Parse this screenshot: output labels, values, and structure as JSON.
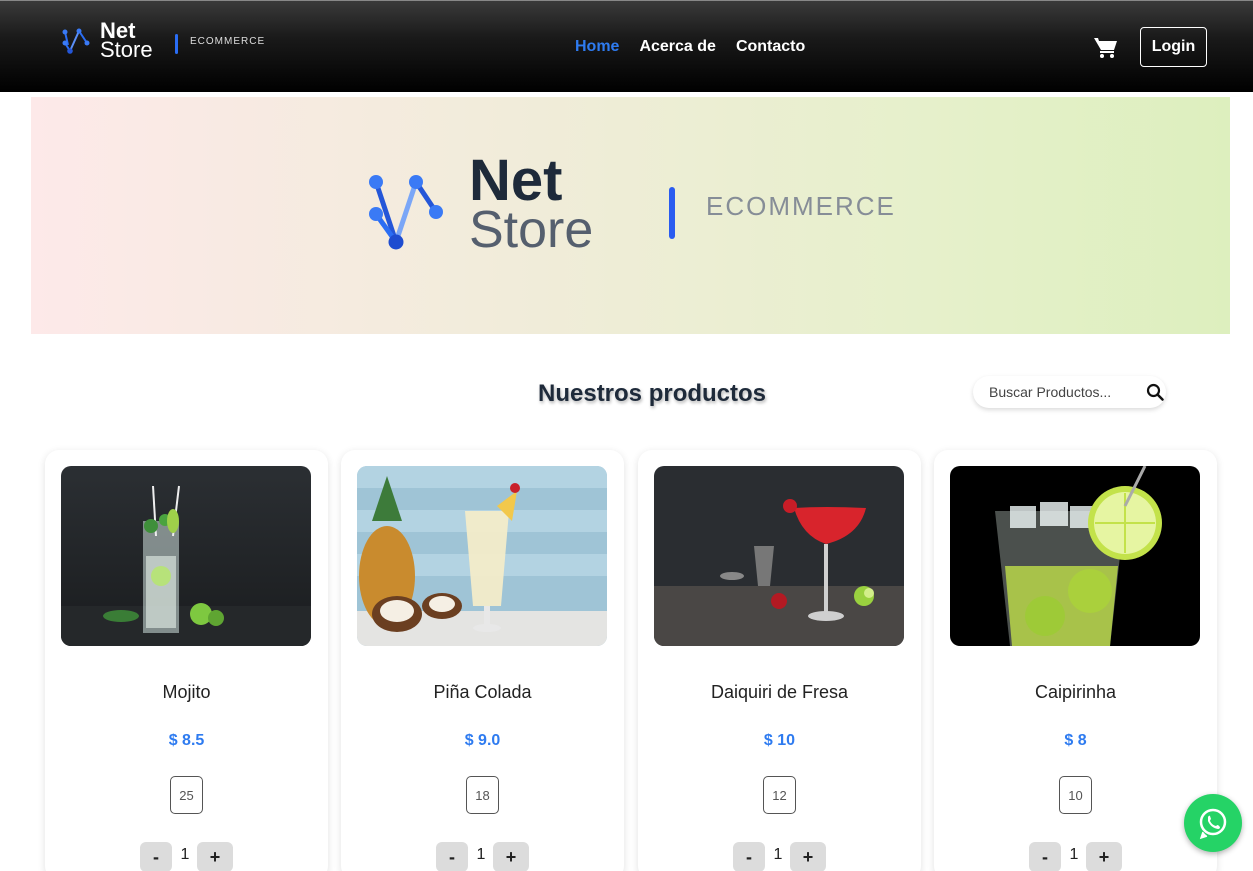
{
  "navbar": {
    "brand_net": "Net",
    "brand_store": "Store",
    "brand_tag": "ECOMMERCE",
    "links": [
      {
        "label": "Home",
        "active": true
      },
      {
        "label": "Acerca de",
        "active": false
      },
      {
        "label": "Contacto",
        "active": false
      }
    ],
    "cart_icon": "cart-icon",
    "login_label": "Login"
  },
  "hero": {
    "brand_net": "Net",
    "brand_store": "Store",
    "brand_tag": "ECOMMERCE"
  },
  "products_section": {
    "title": "Nuestros productos",
    "search_placeholder": "Buscar Productos...",
    "search_icon": "search-icon"
  },
  "products": [
    {
      "name": "Mojito",
      "price": "$ 8.5",
      "stock": "25",
      "quantity": "1"
    },
    {
      "name": "Piña Colada",
      "price": "$ 9.0",
      "stock": "18",
      "quantity": "1"
    },
    {
      "name": "Daiquiri de Fresa",
      "price": "$ 10",
      "stock": "12",
      "quantity": "1"
    },
    {
      "name": "Caipirinha",
      "price": "$ 8",
      "stock": "10",
      "quantity": "1"
    }
  ],
  "qty_controls": {
    "minus_label": "-",
    "plus_label": "+"
  },
  "whatsapp_icon": "whatsapp-icon",
  "colors": {
    "accent": "#2e7bf0",
    "whatsapp": "#25d366",
    "brand_blue": "#2a5cf0"
  }
}
